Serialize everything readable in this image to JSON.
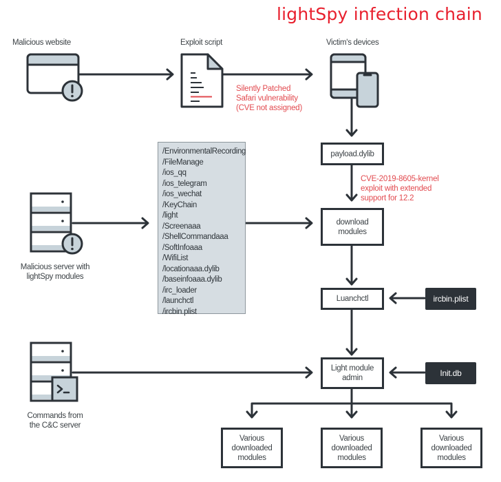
{
  "title": "lightSpy infection chain",
  "nodes": {
    "malicious_website": {
      "label": "Malicious website",
      "icon": "browser-warning-icon"
    },
    "exploit_script": {
      "label": "Exploit script",
      "icon": "document-icon"
    },
    "victim_devices": {
      "label": "Victim's devices",
      "icon": "tablet-phone-icon"
    },
    "malicious_server": {
      "label_line1": "Malicious server with",
      "label_line2": "lightSpy modules",
      "icon": "server-warning-icon"
    },
    "cnc_server": {
      "label_line1": "Commands from",
      "label_line2": "the C&C server",
      "icon": "server-terminal-icon",
      "terminal_glyph": ">_"
    },
    "payload": {
      "label": "payload.dylib"
    },
    "download_modules": {
      "label_line1": "download",
      "label_line2": "modules"
    },
    "launchctl": {
      "label": "Luanchctl"
    },
    "ircbin": {
      "label": "ircbin.plist"
    },
    "light_admin": {
      "label_line1": "Light module",
      "label_line2": "admin"
    },
    "initdb": {
      "label": "Init.db"
    },
    "various": [
      {
        "line1": "Various",
        "line2": "downloaded",
        "line3": "modules"
      },
      {
        "line1": "Various",
        "line2": "downloaded",
        "line3": "modules"
      },
      {
        "line1": "Various",
        "line2": "downloaded",
        "line3": "modules"
      }
    ]
  },
  "notes": {
    "safari": {
      "line1": "Silently Patched",
      "line2": "Safari vulnerability",
      "line3": "(CVE not assigned)"
    },
    "kernel": {
      "line1": "CVE-2019-8605-kernel",
      "line2": "exploit with extended",
      "line3": "support for 12.2"
    }
  },
  "module_list": [
    "/EnvironmentalRecording",
    "/FileManage",
    "/ios_qq",
    "/ios_telegram",
    "/ios_wechat",
    "/KeyChain",
    "/light",
    "/Screenaaa",
    "/ShellCommandaaa",
    "/SoftInfoaaa",
    "/WifiList",
    "/locationaaa.dylib",
    "/baseinfoaaa.dylib",
    "/irc_loader",
    "/launchctl",
    "/ircbin.plist"
  ],
  "colors": {
    "accent_red": "#e8202e",
    "note_red": "#e24a4f",
    "stroke": "#2c3238",
    "icon_fill": "#c7d3da",
    "list_bg": "#d6dde2"
  }
}
